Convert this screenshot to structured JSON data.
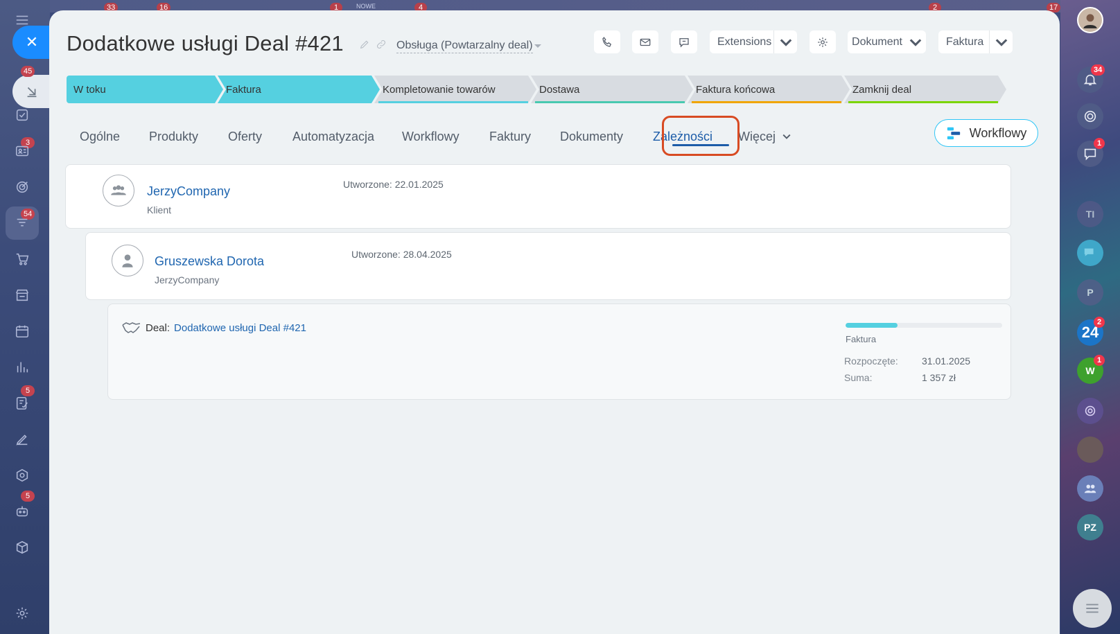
{
  "top_strip": {
    "badges": [
      "33",
      "16",
      "1",
      "4",
      "2",
      "17"
    ],
    "label_new": "NOWE"
  },
  "left_rail": {
    "badges": {
      "tasks": "45",
      "mail": "3",
      "crm": "54",
      "docs": "5",
      "bot": "5"
    }
  },
  "right_rail": {
    "notifications_badge": "34",
    "chat_badge": "1",
    "b24_label": "24",
    "b24_badge": "2",
    "w_label": "W",
    "w_badge": "1",
    "ti_label": "TI",
    "p_label": "P",
    "pz_label": "PZ"
  },
  "header": {
    "title": "Dodatkowe usługi Deal #421",
    "category": "Obsługa (Powtarzalny deal)",
    "extensions_label": "Extensions",
    "dokument_label": "Dokument",
    "faktura_label": "Faktura"
  },
  "stages": [
    {
      "label": "W toku",
      "color": "#55d0e0",
      "bar": ""
    },
    {
      "label": "Faktura",
      "color": "#55d0e0",
      "bar": ""
    },
    {
      "label": "Kompletowanie towarów",
      "color": "#d8dce1",
      "bar": "#55d0e0"
    },
    {
      "label": "Dostawa",
      "color": "#d8dce1",
      "bar": "#48c9b0"
    },
    {
      "label": "Faktura końcowa",
      "color": "#d8dce1",
      "bar": "#f0a500"
    },
    {
      "label": "Zamknij deal",
      "color": "#d8dce1",
      "bar": "#7bd500"
    }
  ],
  "tabs": {
    "items": [
      "Ogólne",
      "Produkty",
      "Oferty",
      "Automatyzacja",
      "Workflowy",
      "Faktury",
      "Dokumenty",
      "Zależności",
      "Więcej"
    ],
    "active": "Zależności"
  },
  "workflowy_button": "Workflowy",
  "company_card": {
    "name": "JerzyCompany",
    "role": "Klient",
    "created": "Utworzone: 22.01.2025"
  },
  "contact_card": {
    "name": "Gruszewska Dorota",
    "company": "JerzyCompany",
    "created": "Utworzone: 28.04.2025"
  },
  "deal_card": {
    "prefix": "Deal:",
    "link": "Dodatkowe usługi Deal #421",
    "progress_fraction": 0.33,
    "stage": "Faktura",
    "started_label": "Rozpoczęte:",
    "started_value": "31.01.2025",
    "sum_label": "Suma:",
    "sum_value": "1 357 zł"
  }
}
